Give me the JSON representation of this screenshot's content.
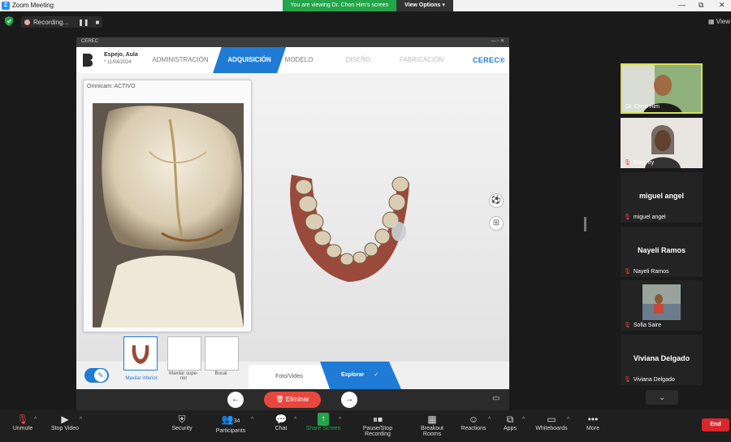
{
  "window": {
    "title": "Zoom Meeting",
    "minimize": "—",
    "restore": "⧉",
    "close": "✕"
  },
  "banner": {
    "text": "You are viewing Dr. Chon Him's screen",
    "view_options": "View Options"
  },
  "recording": {
    "label": "Recording...",
    "pause": "❚❚",
    "stop": "■"
  },
  "view_button": "View",
  "cerec": {
    "window_title": "CEREC",
    "patient_name": "Espejo, Aula",
    "patient_date": "* 11/04/2024",
    "tabs": [
      "ADMINISTRACIÓN",
      "ADQUISICIÓN",
      "MODELO",
      "DISEÑO",
      "FABRICACIÓN"
    ],
    "brand": "CEREC®",
    "omnicam_label": "Omnicam: ACTIVO",
    "thumbs": [
      {
        "label": "Maxilar inferior"
      },
      {
        "label": "Maxilar supe-rior"
      },
      {
        "label": "Bucal"
      }
    ],
    "foto_video": "Foto/Video",
    "explorar": "Explorar",
    "eliminar": "Eliminar"
  },
  "participants": [
    {
      "name": "Dr. Chon Him",
      "video": true,
      "muted": false
    },
    {
      "name": "Mary fry",
      "video": true,
      "muted": true
    },
    {
      "name": "miguel angel",
      "big": "miguel angel",
      "muted": true
    },
    {
      "name": "Nayeli Ramos",
      "big": "Nayeli Ramos",
      "muted": true
    },
    {
      "name": "Sofia Saire",
      "video": true,
      "muted": true
    },
    {
      "name": "Viviana Delgado",
      "big": "Viviana Delgado",
      "muted": true
    }
  ],
  "toolbar": {
    "unmute": "Unmute",
    "stop_video": "Stop Video",
    "security": "Security",
    "participants": "Participants",
    "participants_count": "34",
    "chat": "Chat",
    "share_screen": "Share Screen",
    "recording": "Pause/Stop Recording",
    "breakout": "Breakout Rooms",
    "reactions": "Reactions",
    "apps": "Apps",
    "whiteboards": "Whiteboards",
    "more": "More",
    "end": "End"
  },
  "colors": {
    "accent": "#1f7bd6",
    "share_green": "#23a54a",
    "end_red": "#d8272c",
    "active_speaker": "#d9e04c"
  }
}
